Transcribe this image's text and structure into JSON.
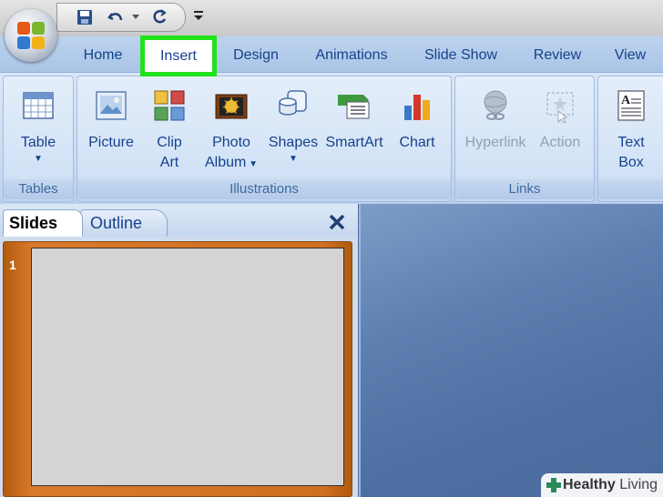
{
  "quick_access": {
    "icons": [
      "save-icon",
      "undo-icon",
      "redo-icon",
      "customize-icon"
    ]
  },
  "tabs": [
    {
      "label": "Home"
    },
    {
      "label": "Insert",
      "active": true
    },
    {
      "label": "Design"
    },
    {
      "label": "Animations"
    },
    {
      "label": "Slide Show"
    },
    {
      "label": "Review"
    },
    {
      "label": "View"
    }
  ],
  "ribbon": {
    "groups": [
      {
        "label": "Tables",
        "buttons": [
          {
            "line1": "Table",
            "has_dropdown": true
          }
        ]
      },
      {
        "label": "Illustrations",
        "buttons": [
          {
            "line1": "Picture"
          },
          {
            "line1": "Clip",
            "line2": "Art"
          },
          {
            "line1": "Photo",
            "line2": "Album",
            "has_dropdown": true
          },
          {
            "line1": "Shapes",
            "has_dropdown": true
          },
          {
            "line1": "SmartArt"
          },
          {
            "line1": "Chart"
          }
        ]
      },
      {
        "label": "Links",
        "buttons": [
          {
            "line1": "Hyperlink",
            "disabled": true
          },
          {
            "line1": "Action",
            "disabled": true
          }
        ]
      },
      {
        "label": "",
        "buttons": [
          {
            "line1": "Text",
            "line2": "Box"
          }
        ]
      }
    ]
  },
  "slides_pane": {
    "tab_slides": "Slides",
    "tab_outline": "Outline",
    "close_icon": "close-icon",
    "slide_number": "1"
  },
  "watermark": {
    "text_bold": "Healthy",
    "text": "Living"
  },
  "colors": {
    "highlight": "#21e21a",
    "tab_text": "#15428b",
    "selection": "#cf6f1f"
  }
}
